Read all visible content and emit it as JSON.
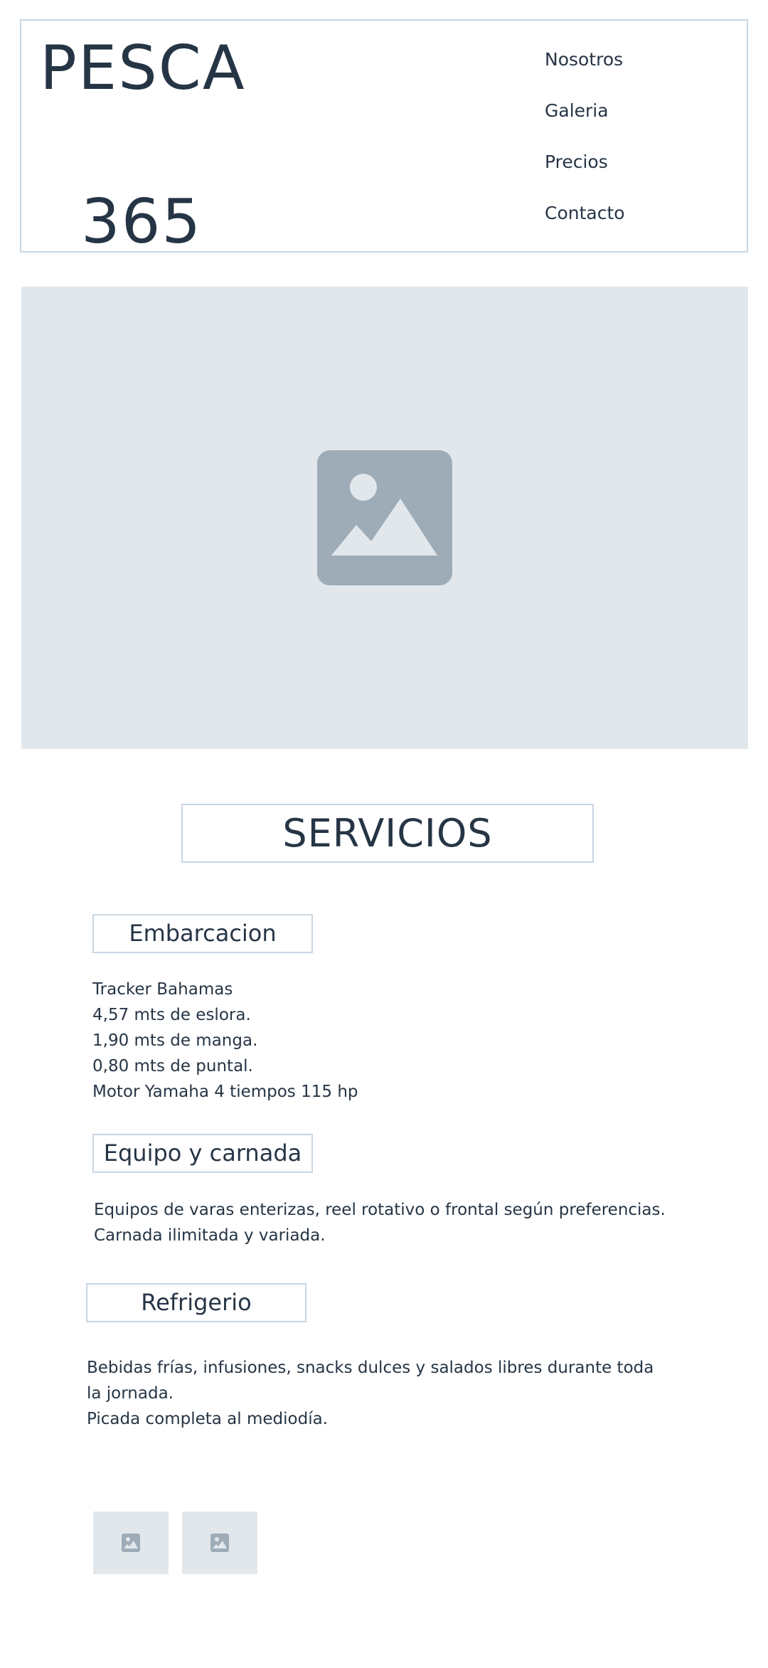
{
  "header": {
    "logo_line1": "PESCA",
    "logo_line2": "365",
    "nav": [
      "Nosotros",
      "Galeria",
      "Precios",
      "Contacto"
    ]
  },
  "hero": {
    "icon": "image-placeholder-icon"
  },
  "servicios": {
    "title": "SERVICIOS",
    "embarcacion": {
      "title": "Embarcacion",
      "lines": [
        "Tracker Bahamas",
        "4,57 mts de eslora.",
        "1,90 mts de manga.",
        "0,80 mts de puntal.",
        "Motor Yamaha 4 tiempos 115 hp"
      ]
    },
    "equipo": {
      "title": "Equipo y carnada",
      "lines": [
        "Equipos de varas enterizas, reel rotativo o frontal según preferencias.",
        "Carnada ilimitada y variada."
      ]
    },
    "refrigerio": {
      "title": "Refrigerio",
      "lines": [
        "Bebidas frías,  infusiones, snacks dulces y salados  libres durante toda",
        "la jornada.",
        "Picada completa al mediodía."
      ]
    }
  },
  "gallery": {
    "thumb_icon": "image-placeholder-icon"
  },
  "colors": {
    "text": "#263545",
    "border": "#c9d6e3",
    "placeholder_bg": "#e2e7eb",
    "placeholder_icon": "#9eacb8"
  }
}
